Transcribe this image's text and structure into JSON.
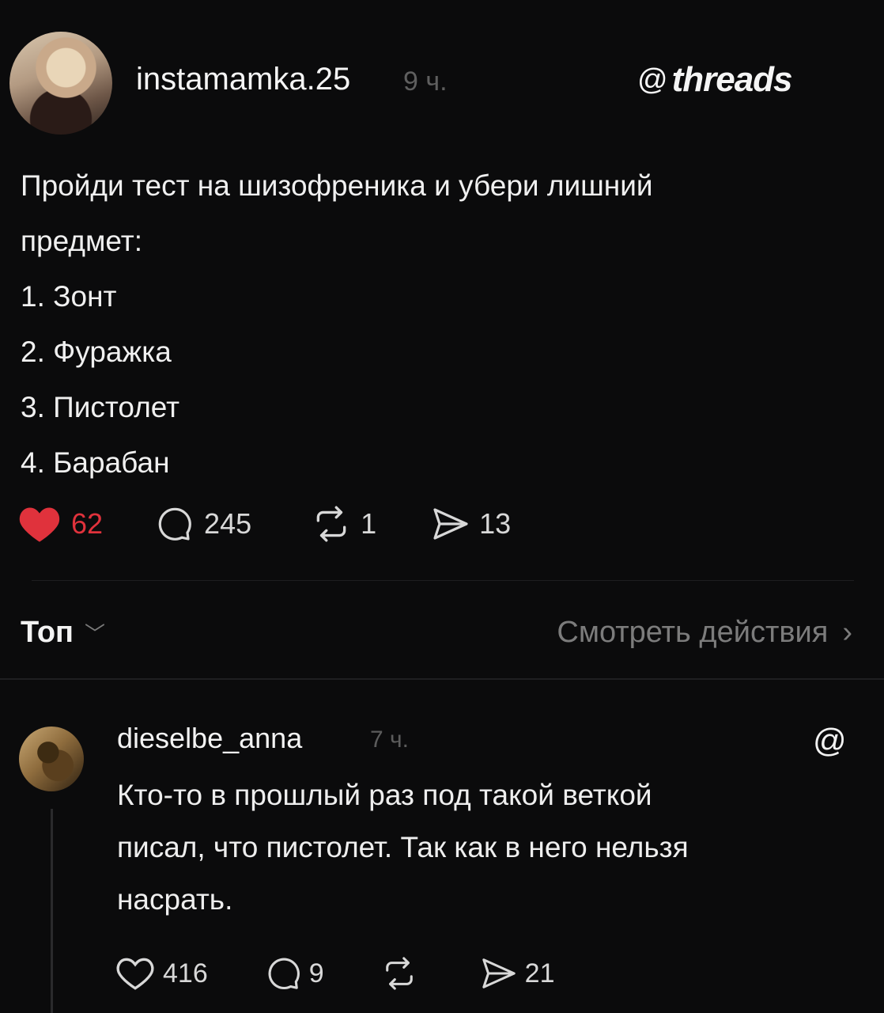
{
  "post": {
    "username": "instamamka.25",
    "time": "9 ч.",
    "brand": "threads",
    "brand_logo": "@",
    "lines": [
      "Пройди тест на шизофреника и убери лишний",
      "предмет:",
      "1. Зонт",
      "2. Фуражка",
      "3. Пистолет",
      "4. Барабан"
    ],
    "likes": "62",
    "comments": "245",
    "reposts": "1",
    "shares": "13",
    "like_color": "#e0323c"
  },
  "sort": {
    "label": "Топ",
    "chevron": "﹀"
  },
  "view_activity": {
    "label": "Смотреть действия",
    "chevron": "›"
  },
  "reply": {
    "username": "dieselbe_anna",
    "time": "7 ч.",
    "logo": "@",
    "lines": [
      "Кто-то в прошлый раз под такой веткой",
      "писал, что пистолет. Так как в него нельзя",
      "насрать."
    ],
    "likes": "416",
    "comments": "9",
    "shares": "21"
  }
}
